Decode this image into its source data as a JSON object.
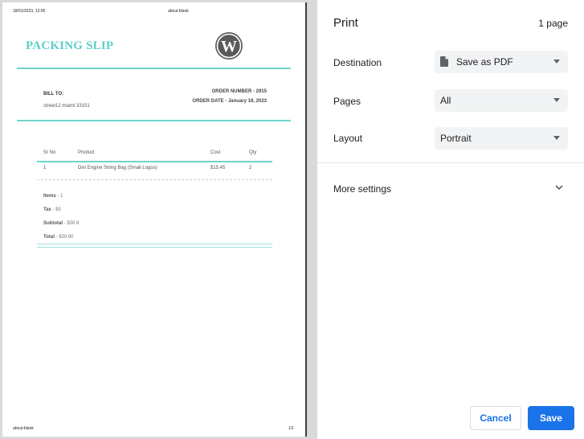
{
  "preview": {
    "header_datetime": "18/01/2023, 12:05",
    "header_url": "about:blank",
    "footer_url": "about:blank",
    "footer_pagenum": "1/1",
    "slip_title": "PACKING SLIP",
    "bill_to_label": "BILL TO:",
    "bill_to_address": "street12 miami 33101",
    "order_number": "ORDER NUMBER - 2915",
    "order_date": "ORDER DATE - January 18, 2023",
    "table": {
      "headers": [
        "Sr No",
        "Product",
        "Cost",
        "Qty"
      ],
      "rows": [
        [
          "1",
          "Divi Engine String Bag (Small Logos)",
          "$15.45",
          "2"
        ]
      ]
    },
    "totals": {
      "items_label": "Items",
      "items_value": " - 1",
      "tax_label": "Tax",
      "tax_value": " - $0",
      "subtotal_label": "Subtotal",
      "subtotal_value": " - $30.9",
      "total_label": "Total",
      "total_value": " - $30.90"
    },
    "accent_color": "#5ccfc9"
  },
  "settings": {
    "title": "Print",
    "page_count": "1 page",
    "destination": {
      "label": "Destination",
      "value": "Save as PDF",
      "icon": "file-icon"
    },
    "pages": {
      "label": "Pages",
      "value": "All"
    },
    "layout": {
      "label": "Layout",
      "value": "Portrait"
    },
    "more_settings": {
      "label": "More settings",
      "icon": "chevron-down-icon"
    },
    "cancel_label": "Cancel",
    "save_label": "Save",
    "primary_color": "#1a73e8"
  }
}
